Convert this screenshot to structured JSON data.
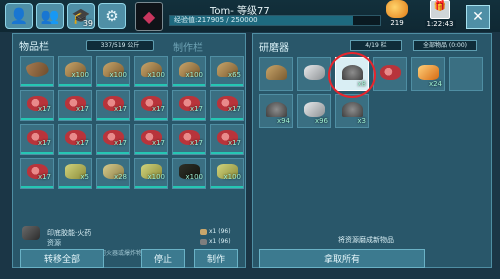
{
  "topbar": {
    "icons": [
      {
        "name": "character-icon",
        "glyph": "👤",
        "count": ""
      },
      {
        "name": "tribe-icon",
        "glyph": "👥",
        "count": ""
      },
      {
        "name": "engram-icon",
        "glyph": "🎓",
        "count": "39"
      },
      {
        "name": "settings-icon",
        "glyph": "⚙",
        "count": ""
      }
    ],
    "emblem_glyph": "◆",
    "player_name": "Tom- 等级77",
    "xp_text": "经验值:217905 / 250000",
    "xp_fraction": 0.87,
    "resource_count": "219",
    "gift_timer": "1:22:43",
    "close_glyph": "✕"
  },
  "inventory": {
    "title": "物品栏",
    "capacity": "337/519 公斤",
    "craft_tab": "制作栏",
    "slots": [
      {
        "item": "hide",
        "qty": ""
      },
      {
        "item": "pestle",
        "qty": "x100"
      },
      {
        "item": "pestle",
        "qty": "x100"
      },
      {
        "item": "pestle",
        "qty": "x100"
      },
      {
        "item": "pestle",
        "qty": "x100"
      },
      {
        "item": "pestle",
        "qty": "x65"
      },
      {
        "item": "meat",
        "qty": "x17"
      },
      {
        "item": "meat",
        "qty": "x17"
      },
      {
        "item": "meat",
        "qty": "x17"
      },
      {
        "item": "meat",
        "qty": "x17"
      },
      {
        "item": "meat",
        "qty": "x17"
      },
      {
        "item": "meat",
        "qty": "x17"
      },
      {
        "item": "meat",
        "qty": "x17"
      },
      {
        "item": "meat",
        "qty": "x17"
      },
      {
        "item": "meat",
        "qty": "x17"
      },
      {
        "item": "meat",
        "qty": "x17"
      },
      {
        "item": "meat",
        "qty": "x17"
      },
      {
        "item": "meat",
        "qty": "x17"
      },
      {
        "item": "meat",
        "qty": "x17"
      },
      {
        "item": "fiber",
        "qty": "x5"
      },
      {
        "item": "thatch",
        "qty": "x28"
      },
      {
        "item": "fiber",
        "qty": "x100"
      },
      {
        "item": "fiber-dark",
        "qty": "x100"
      },
      {
        "item": "fiber",
        "qty": "x100"
      }
    ],
    "selected_title": "印底胶能·火药",
    "selected_sub": "资源",
    "selected_desc": "一种威力的粗混剂，可用于任何火器或爆炸物中。",
    "requirements": [
      {
        "label": "x1 (96)",
        "color": "#c9a66b"
      },
      {
        "label": "x1 (96)",
        "color": "#7e7e7e"
      }
    ],
    "buttons": {
      "transfer_all": "转移全部",
      "stop": "停止",
      "craft": "制作"
    }
  },
  "grinder": {
    "title": "研磨器",
    "capacity": "4/19 栏",
    "filter": "全部物品 (0:00)",
    "slots": [
      {
        "item": "pestle",
        "qty": "",
        "light": false
      },
      {
        "item": "stone",
        "qty": "",
        "light": false
      },
      {
        "item": "powder",
        "qty": "x8",
        "light": true
      },
      {
        "item": "meat",
        "qty": "",
        "light": false
      },
      {
        "item": "crystal",
        "qty": "x24",
        "light": false
      },
      {
        "item": "",
        "qty": "",
        "light": false
      },
      {
        "item": "powder",
        "qty": "x94",
        "light": false
      },
      {
        "item": "stone",
        "qty": "x96",
        "light": false
      },
      {
        "item": "powder",
        "qty": "x3",
        "light": false
      }
    ],
    "note": "将资源磨成新物品",
    "take_all": "拿取所有"
  }
}
